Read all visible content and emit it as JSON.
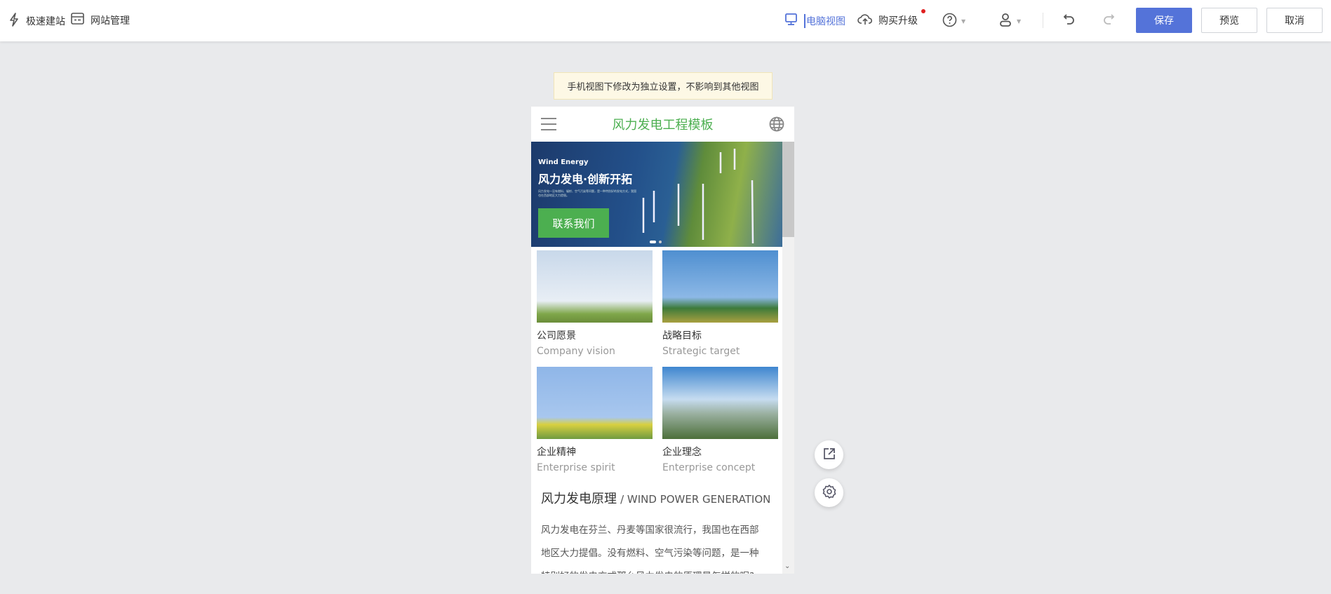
{
  "topbar": {
    "quick_build": "极速建站",
    "site_manage": "网站管理",
    "desktop_view": "电脑视图",
    "upgrade": "购买升级",
    "save": "保存",
    "preview": "预览",
    "cancel": "取消"
  },
  "notice": "手机视图下修改为独立设置，不影响到其他视图",
  "phone": {
    "title": "风力发电工程模板",
    "banner": {
      "en": "Wind Energy",
      "headline": "风力发电·创新开拓",
      "desc": "风力发电一没有燃料、辐射、空气污染等问题，是一种特别好的发电方式，我国也在西部地区大力提倡。",
      "cta": "联系我们"
    },
    "cards": [
      {
        "title": "公司愿景",
        "subtitle": "Company vision"
      },
      {
        "title": "战略目标",
        "subtitle": "Strategic target"
      },
      {
        "title": "企业精神",
        "subtitle": "Enterprise spirit"
      },
      {
        "title": "企业理念",
        "subtitle": "Enterprise concept"
      }
    ],
    "section": {
      "title": "风力发电原理",
      "subtitle": "/ WIND POWER GENERATION",
      "lines": [
        "风力发电在芬兰、丹麦等国家很流行，我国也在西部",
        "地区大力提倡。没有燃料、空气污染等问题，是一种",
        "特别好的发电方式那么风力发电的原理是怎样的呢?"
      ]
    }
  },
  "colors": {
    "accent": "#5473d9",
    "green": "#4caf50"
  }
}
